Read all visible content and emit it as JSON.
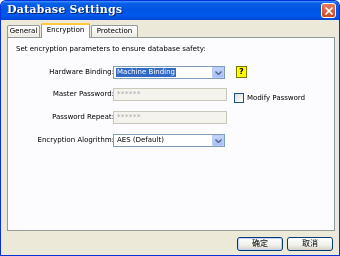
{
  "window": {
    "title": "Database Settings"
  },
  "tabs": [
    {
      "label": "General",
      "active": false
    },
    {
      "label": "Encryption",
      "active": true
    },
    {
      "label": "Protection",
      "active": false
    }
  ],
  "encryption": {
    "intro": "Set encryption parameters to ensure database safety:",
    "hardware_binding": {
      "label": "Hardware Binding:",
      "value": "Machine Binding",
      "help": "?"
    },
    "master_password": {
      "label": "Master Password:",
      "value": "******",
      "modify_label": "Modify Password",
      "modify_checked": false
    },
    "password_repeat": {
      "label": "Password Repeat:",
      "value": "******"
    },
    "algorithm": {
      "label": "Encryption Alogrithm:",
      "value": "AES (Default)"
    }
  },
  "buttons": {
    "ok": "确定",
    "cancel": "取消"
  },
  "colors": {
    "titlebar": "#0054e3",
    "selection": "#316ac5",
    "active_tab_accent": "#ffc83c",
    "dialog_bg": "#ece9d8"
  }
}
